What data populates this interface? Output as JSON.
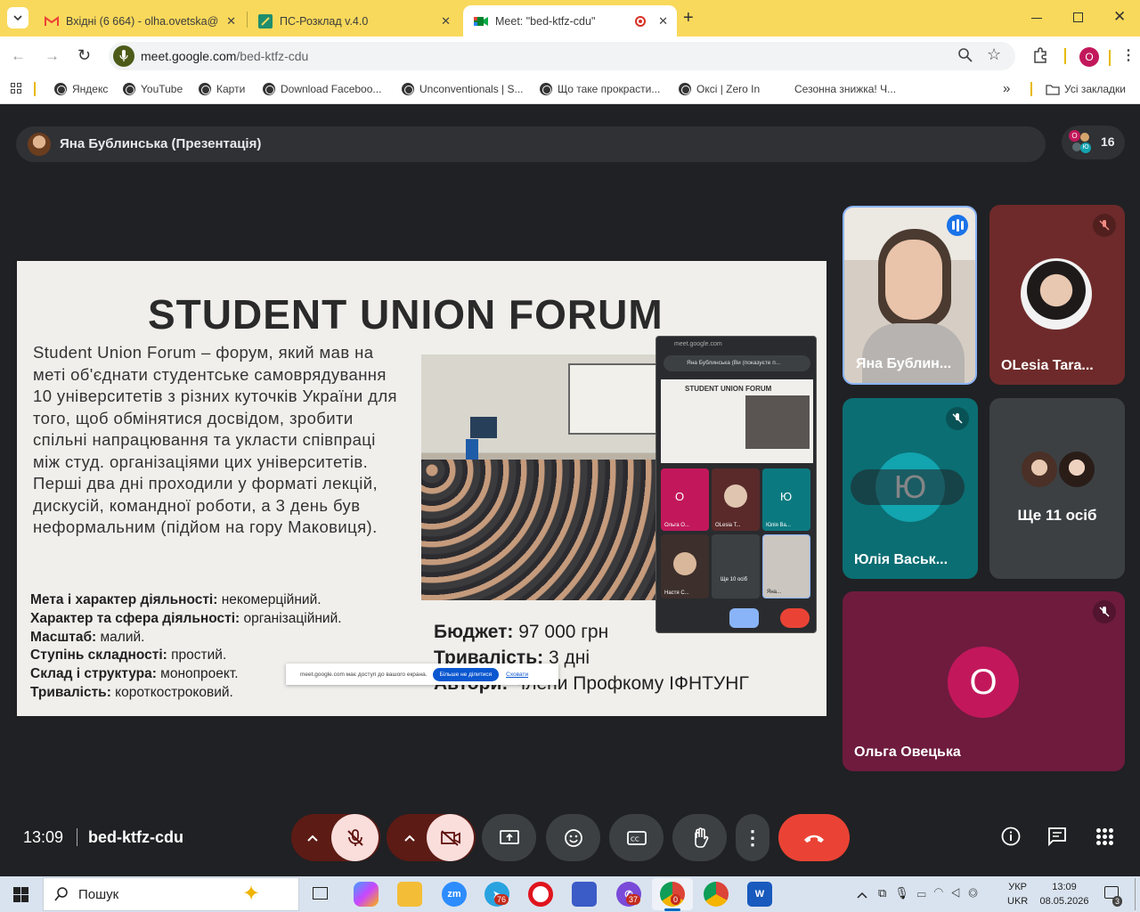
{
  "browser": {
    "tabs": [
      {
        "title": "Вхідні (6 664) - olha.ovetska@n",
        "icon": "gmail-icon"
      },
      {
        "title": "ПС-Розклад v.4.0",
        "icon": "sheets-icon"
      },
      {
        "title": "Meet: \"bed-ktfz-cdu\"",
        "icon": "meet-icon",
        "active": true
      }
    ],
    "url_domain": "meet.google.com",
    "url_path": "/bed-ktfz-cdu",
    "profile_initial": "O",
    "bookmarks": [
      "Яндекс",
      "YouTube",
      "Карти",
      "Download Faceboo...",
      "Unconventionals | S...",
      "Що таке прокрасти...",
      "Оксі | Zero In",
      "Сезонна знижка! Ч..."
    ],
    "all_bookmarks": "Усі закладки"
  },
  "meet": {
    "presenter_label": "Яна Бублинська (Презентація)",
    "participant_count": "16",
    "time": "13:09",
    "meeting_code": "bed-ktfz-cdu",
    "tiles": [
      {
        "name": "Яна Бублин...",
        "speaking": true
      },
      {
        "name": "OLesia Tara..."
      },
      {
        "name": "Юлія Васьк...",
        "initial": "Ю"
      },
      {
        "name": "Ще 11 осіб"
      },
      {
        "name": "Ольга Овецька",
        "initial": "О"
      }
    ],
    "accent": "#1a73e8",
    "end_color": "#ea4335"
  },
  "slide": {
    "title": "STUDENT UNION FORUM",
    "paragraph": "Student Union Forum – форум, який мав на меті об'єднати студентське самоврядування 10 університетів з різних куточків України для того, щоб обмінятися досвідом, зробити спільні напрацювання та укласти співпраці між студ. організаціями цих університетів. Перші два дні проходили у форматі лекцій, дискусій, командної роботи, а 3 день був неформальним (підйом на гору Маковиця).",
    "facts": [
      {
        "label": "Мета і характер діяльності:",
        "value": " некомерційний."
      },
      {
        "label": "Характер та сфера діяльності:",
        "value": " організаційний."
      },
      {
        "label": "Масштаб:",
        "value": " малий."
      },
      {
        "label": "Ступінь складності:",
        "value": " простий."
      },
      {
        "label": "Склад і структура:",
        "value": " монопроект."
      },
      {
        "label": "Тривалість:",
        "value": " короткостроковий."
      }
    ],
    "budget_label": "Бюджет:",
    "budget_value": " 97 000 грн",
    "duration_label": "Тривалість:",
    "duration_value": " 3 дні",
    "authors_label": "Автори:",
    "authors_value": " Члени Профкому ІФНТУНГ",
    "share_bar_text": "meet.google.com має доступ до вашого екрана.",
    "share_stop": "Більше не ділитися",
    "share_hide": "Сховати",
    "pip": {
      "url": "meet.google.com",
      "header": "Яна Бублинська (Ви (показуєте п...",
      "names": [
        "Ольга О...",
        "OLesia T...",
        "Юлія Ва...",
        "Настя С...",
        "Ще 10 осіб",
        "Яна..."
      ]
    }
  },
  "taskbar": {
    "search_placeholder": "Пошук",
    "lang1": "УКР",
    "lang2": "UKR",
    "clock_time": "13:09",
    "clock_date": "08.05.2026",
    "telegram_badge": "76",
    "viber_badge": "37",
    "chrome_badge": "0",
    "notif_badge": "3"
  }
}
